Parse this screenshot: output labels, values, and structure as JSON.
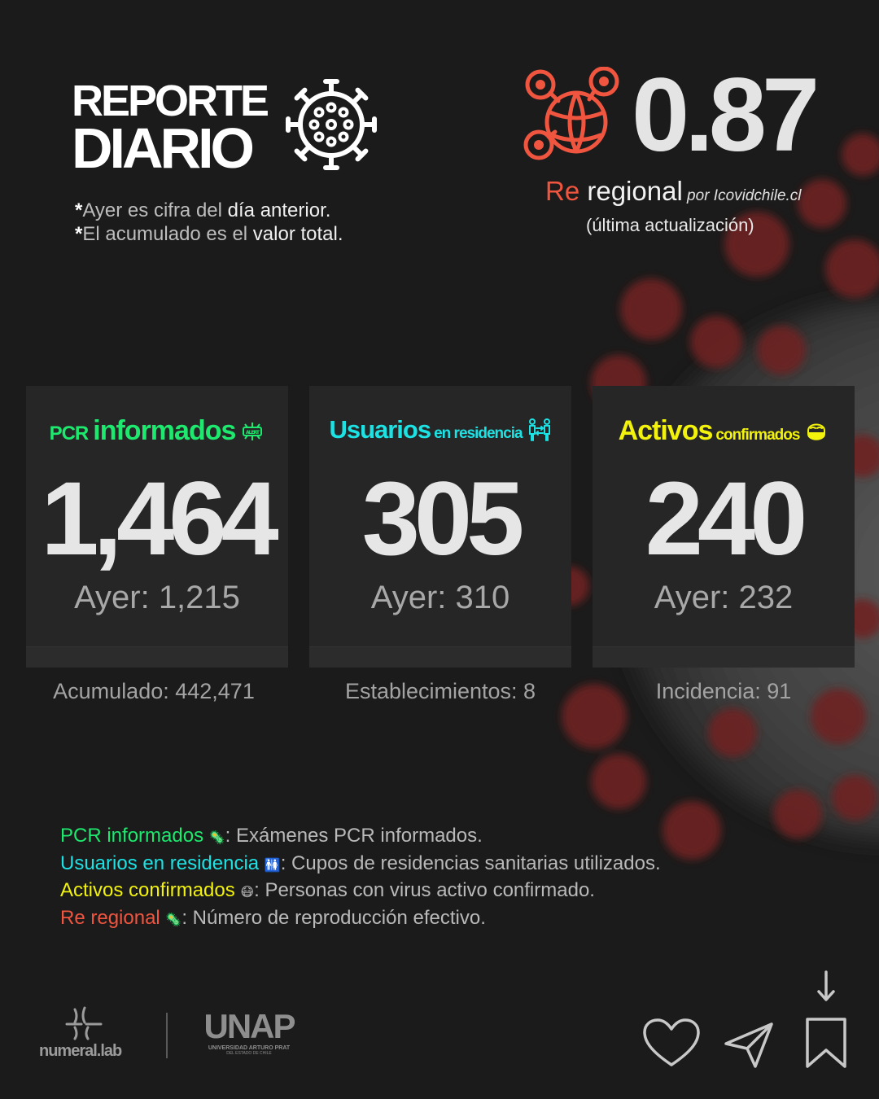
{
  "header": {
    "title_line1": "REPORTE",
    "title_line2": "DIARIO",
    "notes": [
      {
        "star": "*",
        "pre": "Ayer es cifra del ",
        "hl": "día anterior."
      },
      {
        "star": "*",
        "pre": "El acumulado es el ",
        "hl": "valor total."
      }
    ]
  },
  "re": {
    "value": "0.87",
    "label_red": "Re",
    "label": " regional",
    "source": " por Icovidchile.cl",
    "updated": "(última actualización)"
  },
  "cards": [
    {
      "title_small_pre": "PCR",
      "title_big": "informados",
      "title_small_post": "",
      "value": "1,464",
      "ayer": "Ayer: 1,215",
      "sub": "Acumulado: 442,471"
    },
    {
      "title_small_pre": "",
      "title_big": "Usuarios",
      "title_small_post": "en residencia",
      "value": "305",
      "ayer": "Ayer: 310",
      "sub": "Establecimientos: 8"
    },
    {
      "title_small_pre": "",
      "title_big": "Activos",
      "title_small_post": "confirmados",
      "value": "240",
      "ayer": "Ayer: 232",
      "sub": "Incidencia: 91"
    }
  ],
  "legend": [
    {
      "term": "PCR informados",
      "icon": "🦠",
      "desc": ": Exámenes PCR informados."
    },
    {
      "term": "Usuarios en residencia",
      "icon": "🚻",
      "desc": ": Cupos de residencias sanitarias utilizados."
    },
    {
      "term": "Activos confirmados",
      "icon": "😷",
      "desc": ": Personas con virus activo confirmado."
    },
    {
      "term": "Re regional",
      "icon": "🦠",
      "desc": ": Número de reproducción efectivo."
    }
  ],
  "footer": {
    "numeral": "numeral.lab",
    "unap": "UNAP",
    "unap_sub1": "UNIVERSIDAD ARTURO PRAT",
    "unap_sub2": "DEL ESTADO DE CHILE"
  },
  "colors": {
    "green": "#1ee96f",
    "cyan": "#1de2e4",
    "yellow": "#f2f20c",
    "red": "#f0553f"
  }
}
